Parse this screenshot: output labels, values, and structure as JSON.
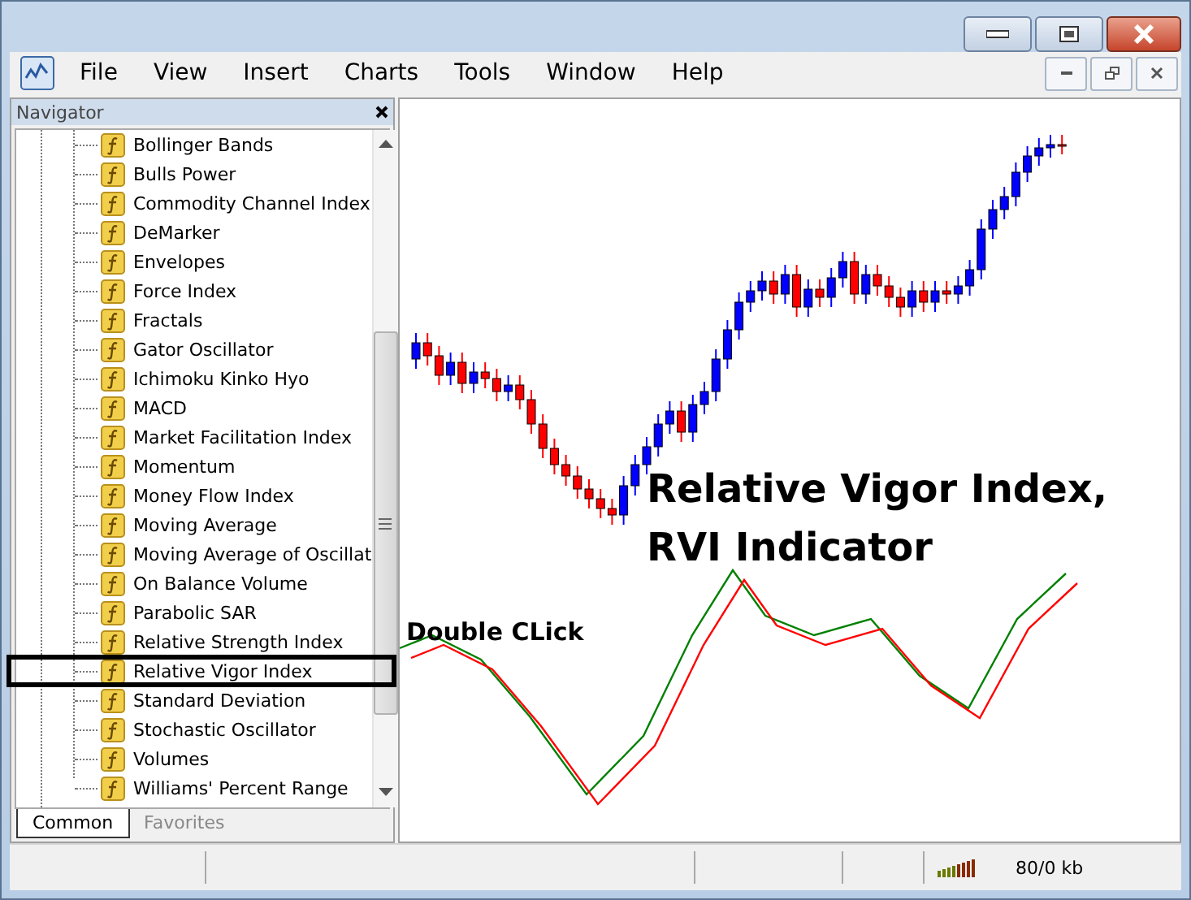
{
  "menu": [
    "File",
    "View",
    "Insert",
    "Charts",
    "Tools",
    "Window",
    "Help"
  ],
  "navigator": {
    "title": "Navigator",
    "items": [
      {
        "label": "Bollinger Bands",
        "highlighted": false
      },
      {
        "label": "Bulls Power",
        "highlighted": false
      },
      {
        "label": "Commodity Channel Index",
        "highlighted": false
      },
      {
        "label": "DeMarker",
        "highlighted": false
      },
      {
        "label": "Envelopes",
        "highlighted": false
      },
      {
        "label": "Force Index",
        "highlighted": false
      },
      {
        "label": "Fractals",
        "highlighted": false
      },
      {
        "label": "Gator Oscillator",
        "highlighted": false
      },
      {
        "label": "Ichimoku Kinko Hyo",
        "highlighted": false
      },
      {
        "label": "MACD",
        "highlighted": false
      },
      {
        "label": "Market Facilitation Index",
        "highlighted": false
      },
      {
        "label": "Momentum",
        "highlighted": false
      },
      {
        "label": "Money Flow Index",
        "highlighted": false
      },
      {
        "label": "Moving Average",
        "highlighted": false
      },
      {
        "label": "Moving Average of Oscillat",
        "highlighted": false
      },
      {
        "label": "On Balance Volume",
        "highlighted": false
      },
      {
        "label": "Parabolic SAR",
        "highlighted": false
      },
      {
        "label": "Relative Strength Index",
        "highlighted": false
      },
      {
        "label": "Relative Vigor Index",
        "highlighted": true
      },
      {
        "label": "Standard Deviation",
        "highlighted": false
      },
      {
        "label": "Stochastic Oscillator",
        "highlighted": false
      },
      {
        "label": "Volumes",
        "highlighted": false
      },
      {
        "label": "Williams' Percent Range",
        "highlighted": false
      }
    ],
    "tabs": [
      {
        "label": "Common",
        "selected": true
      },
      {
        "label": "Favorites",
        "selected": false
      }
    ]
  },
  "chart": {
    "caption_lines": [
      "Relative Vigor Index,",
      "RVI Indicator"
    ],
    "callout": "Double CLick"
  },
  "status_bar": {
    "traffic": "80/0 kb"
  }
}
